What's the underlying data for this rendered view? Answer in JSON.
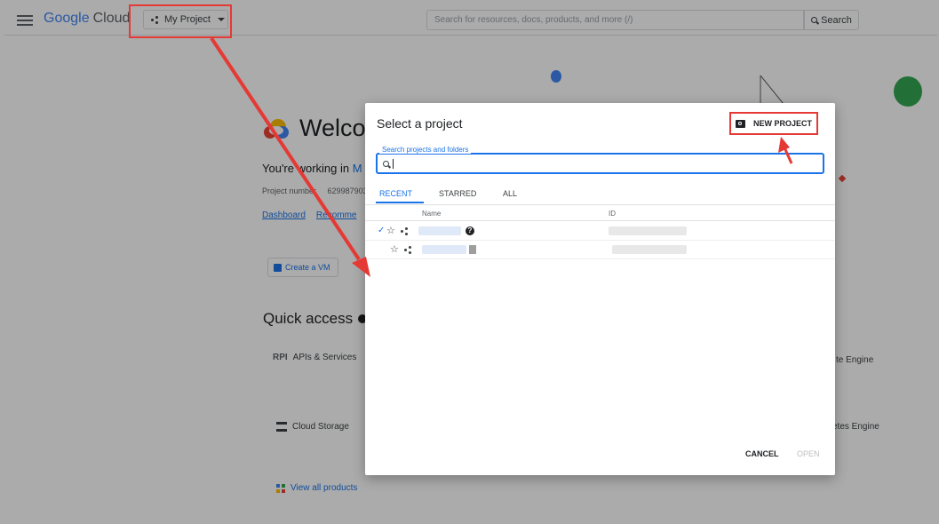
{
  "header": {
    "logo_google": "Google",
    "logo_cloud": "Cloud",
    "project_selector": "My Project",
    "search_placeholder": "Search for resources, docs, products, and more (/)",
    "search_button": "Search"
  },
  "background": {
    "welcome": "Welcom",
    "working_prefix": "You're working in",
    "working_project": "M",
    "project_number_label": "Project number",
    "project_number_value": "629987903",
    "links": [
      "Dashboard",
      "Recomme"
    ],
    "create_vm": "Create a VM",
    "quick_access": "Quick access",
    "api_badge": "RPI",
    "apis_services": "APIs & Services",
    "cloud_storage": "Cloud Storage",
    "view_all": "View all products",
    "compute_engine_partial": "te Engine",
    "kubernetes_partial": "etes Engine"
  },
  "dialog": {
    "title": "Select a project",
    "new_project": "NEW PROJECT",
    "search_label": "Search projects and folders",
    "search_value": "",
    "tabs": [
      "RECENT",
      "STARRED",
      "ALL"
    ],
    "active_tab": "RECENT",
    "columns": {
      "name": "Name",
      "id": "ID"
    },
    "rows": [
      {
        "selected": true,
        "starred": false
      },
      {
        "selected": false,
        "starred": false
      }
    ],
    "cancel": "CANCEL",
    "open": "OPEN"
  },
  "annotation_color": "#e53935"
}
